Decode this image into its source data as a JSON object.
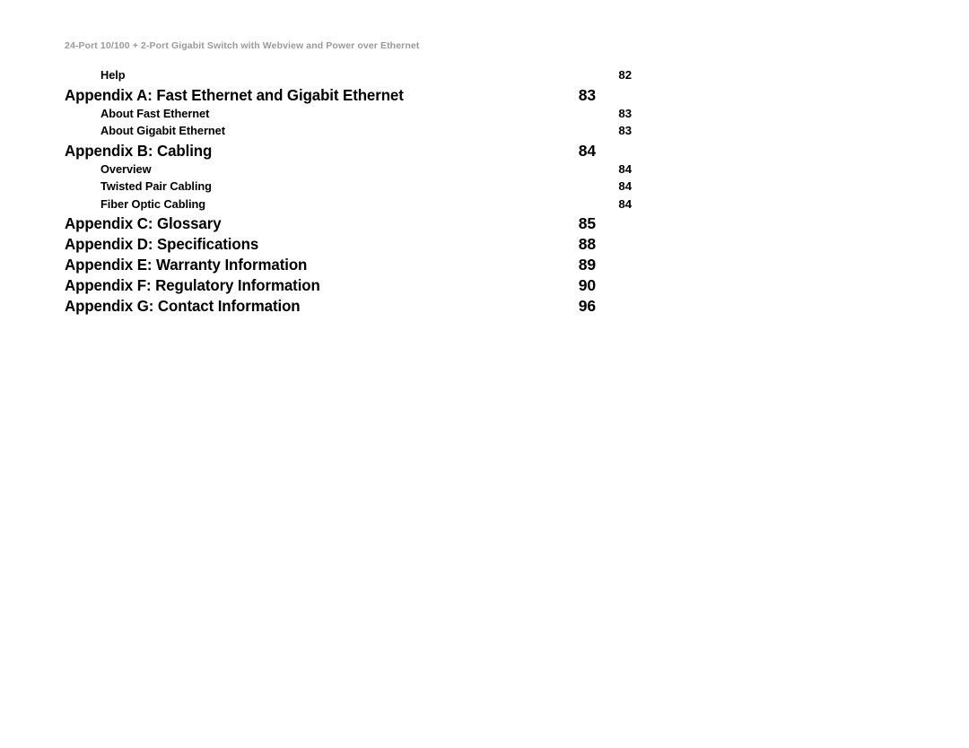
{
  "document": {
    "running_header": "24-Port 10/100 + 2-Port Gigabit Switch with Webview and Power over Ethernet"
  },
  "toc": {
    "entries": [
      {
        "level": 2,
        "title": "Help",
        "page": "82"
      },
      {
        "level": 1,
        "title": "Appendix A: Fast Ethernet and Gigabit Ethernet",
        "page": "83"
      },
      {
        "level": 2,
        "title": "About Fast Ethernet",
        "page": "83"
      },
      {
        "level": 2,
        "title": "About Gigabit Ethernet",
        "page": "83"
      },
      {
        "level": 1,
        "title": "Appendix B: Cabling",
        "page": "84"
      },
      {
        "level": 2,
        "title": "Overview",
        "page": "84"
      },
      {
        "level": 2,
        "title": "Twisted Pair Cabling",
        "page": "84"
      },
      {
        "level": 2,
        "title": "Fiber Optic Cabling",
        "page": "84"
      },
      {
        "level": 1,
        "title": "Appendix C: Glossary",
        "page": "85"
      },
      {
        "level": 1,
        "title": "Appendix D: Specifications",
        "page": "88"
      },
      {
        "level": 1,
        "title": "Appendix E: Warranty Information",
        "page": "89"
      },
      {
        "level": 1,
        "title": "Appendix F: Regulatory Information",
        "page": "90"
      },
      {
        "level": 1,
        "title": "Appendix G: Contact Information",
        "page": "96"
      }
    ]
  },
  "colors": {
    "page_background": "#ffffff",
    "body_text": "#000000",
    "running_header_text": "#9a9a9a"
  }
}
